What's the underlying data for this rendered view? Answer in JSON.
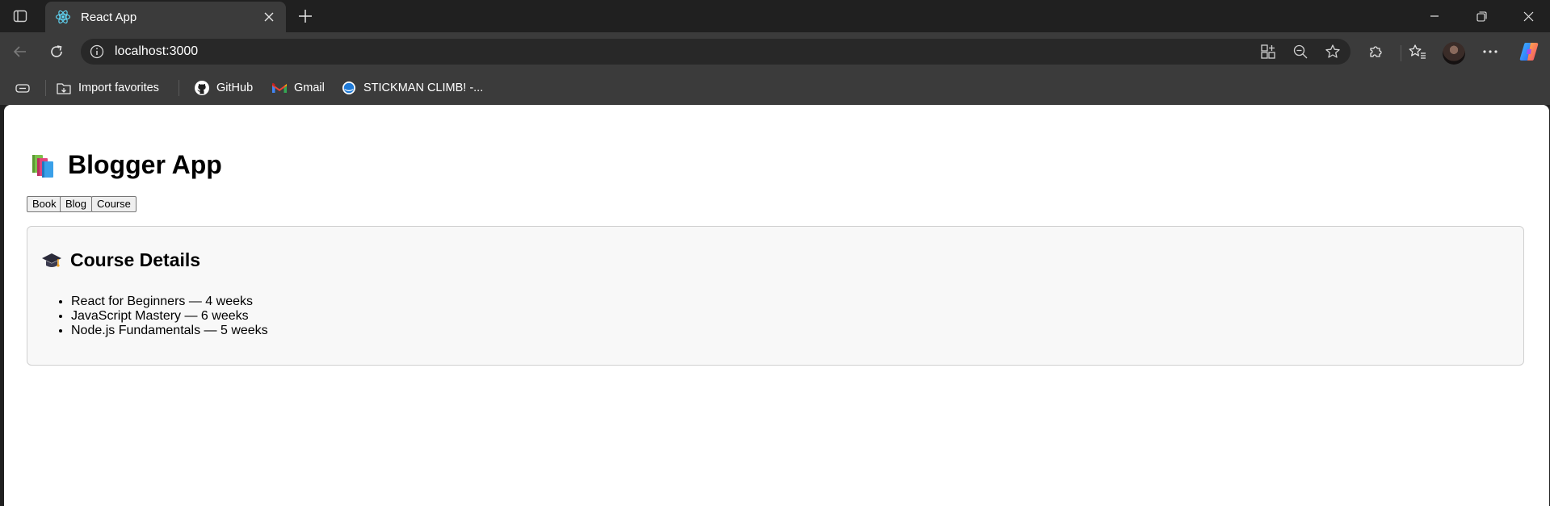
{
  "browser": {
    "tab": {
      "title": "React App",
      "favicon": "react-logo-icon"
    },
    "address_bar": {
      "url": "localhost:3000"
    },
    "bookmarks": [
      {
        "label": "Import favorites",
        "icon": "import-icon"
      },
      {
        "label": "GitHub",
        "icon": "github-icon"
      },
      {
        "label": "Gmail",
        "icon": "gmail-icon"
      },
      {
        "label": "STICKMAN CLIMB! -...",
        "icon": "stickman-icon"
      }
    ],
    "colors": {
      "chrome": "#202020",
      "toolbar": "#3b3b3b",
      "omnibox": "#282828"
    }
  },
  "page": {
    "title": "Blogger App",
    "title_icon": "books-icon",
    "nav": [
      {
        "label": "Book"
      },
      {
        "label": "Blog"
      },
      {
        "label": "Course"
      }
    ],
    "card": {
      "title": "Course Details",
      "icon": "graduation-cap-icon",
      "items": [
        "React for Beginners — 4 weeks",
        "JavaScript Mastery — 6 weeks",
        "Node.js Fundamentals — 5 weeks"
      ]
    }
  }
}
